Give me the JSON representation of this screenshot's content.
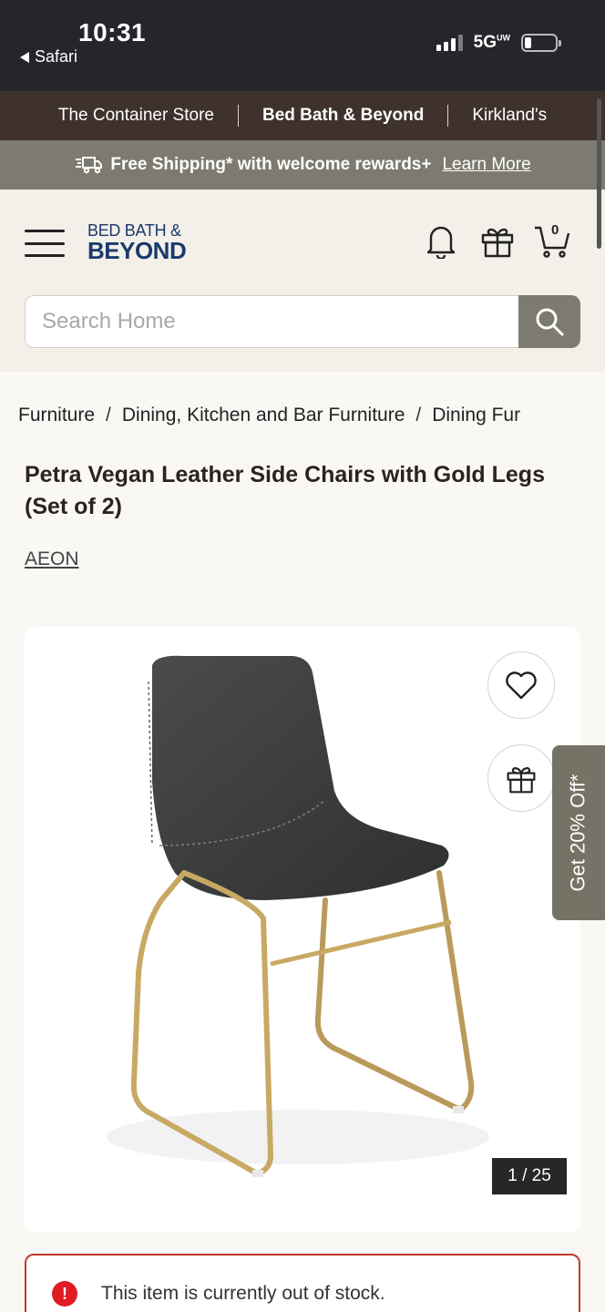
{
  "status_bar": {
    "time": "10:31",
    "back_label": "Safari",
    "network": "5G",
    "network_sub": "UW"
  },
  "brand_bar": {
    "brands": [
      "The Container Store",
      "Bed Bath & Beyond",
      "Kirkland's"
    ],
    "active": "Bed Bath & Beyond"
  },
  "shipping": {
    "text": "Free Shipping* with welcome rewards+",
    "link": "Learn More",
    "icon": "fast-shipping-icon"
  },
  "header": {
    "logo_line1": "BED BATH &",
    "logo_line2": "BEYOND",
    "cart_count": "0",
    "icons": [
      "menu-icon",
      "bell-icon",
      "gift-icon",
      "cart-icon"
    ]
  },
  "search": {
    "placeholder": "Search Home",
    "icon": "search-icon"
  },
  "breadcrumb": {
    "items": [
      "Furniture",
      "Dining, Kitchen and Bar Furniture",
      "Dining Fur"
    ]
  },
  "product": {
    "title": "Petra Vegan Leather Side Chairs with Gold Legs (Set of 2)",
    "vendor": "AEON",
    "image_counter": "1 / 25"
  },
  "promo_tab": {
    "label": "Get 20% Off*"
  },
  "alert": {
    "text": "This item is currently out of stock.",
    "icon_glyph": "!"
  },
  "colors": {
    "brand_bar_bg": "#3f322c",
    "shipping_bg": "#7d7b6f",
    "header_bg": "#f3efe9",
    "logo_blue": "#1a3a6b",
    "alert_red": "#e01b24"
  }
}
